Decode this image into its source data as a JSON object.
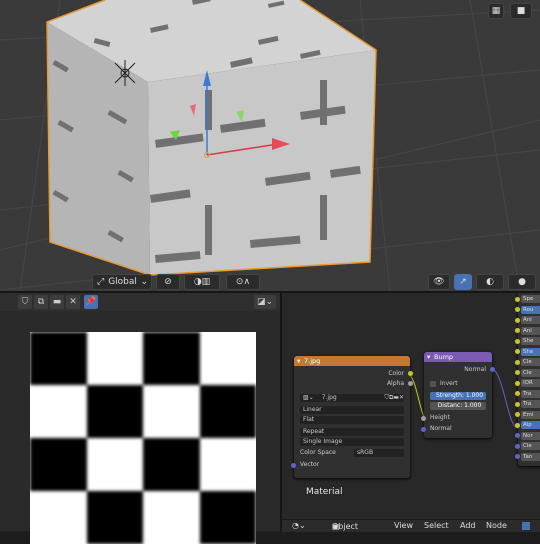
{
  "viewport": {
    "transform_orientation": "Global",
    "header_icons": [
      "grid-icon",
      "camera-icon",
      "view-icon",
      "gizmo-icon",
      "overlay-icon",
      "shading-icon"
    ]
  },
  "image_editor": {
    "toolbar_icons": [
      "shield-icon",
      "duplicate-icon",
      "folder-icon",
      "close-icon",
      "pin-icon"
    ],
    "checker_image": true
  },
  "node_editor": {
    "image_node": {
      "title": "7.jpg",
      "outputs": [
        "Color",
        "Alpha"
      ],
      "image_name": "7.jpg",
      "interpolation": "Linear",
      "projection": "Flat",
      "extension": "Repeat",
      "source": "Single Image",
      "color_space_label": "Color Space",
      "color_space_value": "sRGB",
      "vector_input": "Vector"
    },
    "bump_node": {
      "title": "Bump",
      "output": "Normal",
      "invert_label": "Invert",
      "strength": "Strength: 1.000",
      "distance": "Distanc: 1.000",
      "height_input": "Height",
      "normal_input": "Normal"
    },
    "bsdf_rows": [
      "Spe",
      "Rou",
      "Ani",
      "Ani",
      "She",
      "She",
      "Cle",
      "Cle",
      "IOR",
      "Tra",
      "Tra",
      "Emi",
      "Alp",
      "Nor",
      "Cle",
      "Tan"
    ],
    "material_name": "Material",
    "bottom_bar": {
      "mode": "Object",
      "menus": [
        "View",
        "Select",
        "Add",
        "Node"
      ]
    },
    "colors": {
      "image_header": "#c27a30",
      "bump_header": "#7b5ab3",
      "accent": "#4772b3"
    }
  }
}
